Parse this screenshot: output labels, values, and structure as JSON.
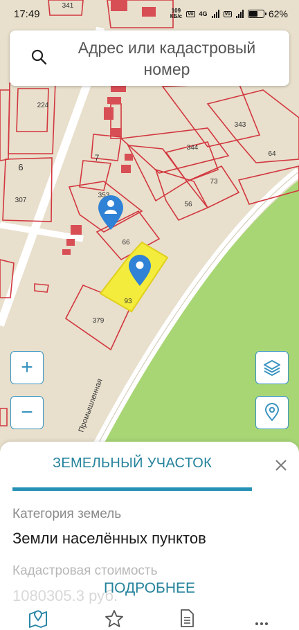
{
  "status": {
    "time": "17:49",
    "speed_value": "109",
    "speed_unit": "КБ/с",
    "network": "4G",
    "battery": "62%"
  },
  "search": {
    "placeholder": "Адрес или кадастровый номер"
  },
  "map": {
    "labels": {
      "p341": "341",
      "p224": "224",
      "p6": "6",
      "p307": "307",
      "p7": "7",
      "p343": "343",
      "p344": "344",
      "p64": "64",
      "p73": "73",
      "p56": "56",
      "p353": "353",
      "p66": "66",
      "p93": "93",
      "p379": "379",
      "street": "Промышленная"
    }
  },
  "controls": {
    "zoom_in": "+",
    "zoom_out": "−"
  },
  "panel": {
    "title": "ЗЕМЕЛЬНЫЙ УЧАСТОК",
    "category_label": "Категория земель",
    "category_value": "Земли населённых пунктов",
    "cost_label": "Кадастровая стоимость",
    "cost_value": "1080305.3 руб.",
    "more_button": "ПОДРОБНЕЕ"
  },
  "nav": {
    "items": [
      "map-icon",
      "star-icon",
      "document-icon",
      "more-icon"
    ]
  },
  "colors": {
    "accent": "#23829b",
    "parcel_border": "#d2373f",
    "selected_parcel": "#f4ec3c",
    "park": "#a8d675",
    "road": "#ffffff",
    "ground": "#e8dfcc",
    "marker": "#2f82d6"
  }
}
